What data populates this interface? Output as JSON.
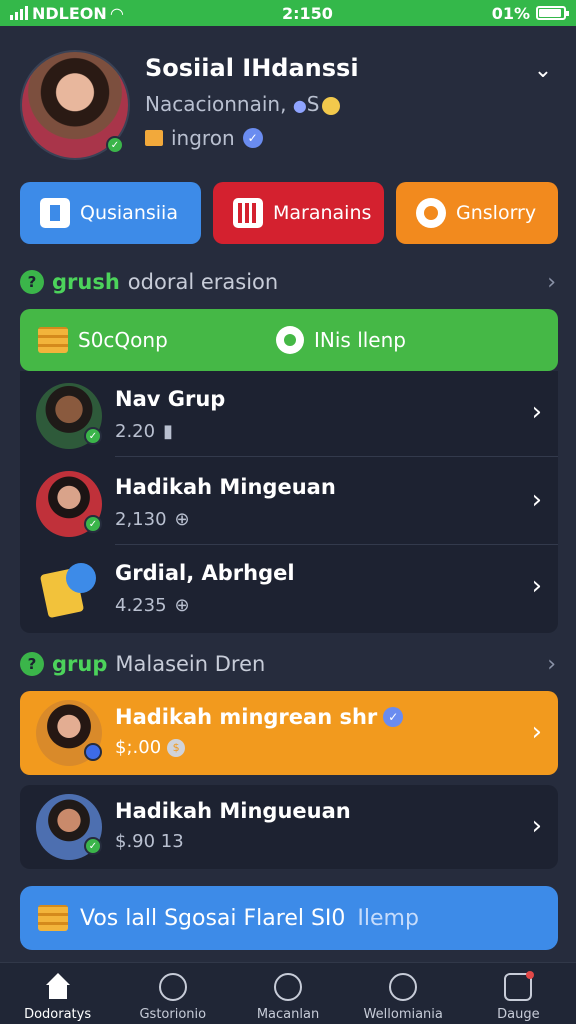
{
  "status_bar": {
    "carrier": "NDLEON",
    "time": "2:150",
    "battery": "01%"
  },
  "profile": {
    "name": "Sosiial IHdanssi",
    "subtitle": "Nacacionnain,",
    "subtitle_suffix": "S",
    "tag": "ingron"
  },
  "actions": [
    {
      "label": "Qusiansiia"
    },
    {
      "label": "Maranains"
    },
    {
      "label": "Gnslorry"
    }
  ],
  "section1": {
    "accent": "grush",
    "rest": "odoral erasion"
  },
  "green_bar": {
    "left_label": "S0cQonp",
    "right_label": "INis llenp"
  },
  "list1": [
    {
      "title": "Nav Grup",
      "meta": "2.20"
    },
    {
      "title": "Hadikah Mingeuan",
      "meta": "2,130"
    },
    {
      "title": "Grdial, Abrhgel",
      "meta": "4.235"
    }
  ],
  "section2": {
    "accent": "grup",
    "rest": "Malasein Dren"
  },
  "featured": {
    "title": "Hadikah mingrean shr",
    "meta": "$;.00"
  },
  "dark_row": {
    "title": "Hadikah Mingueuan",
    "meta": "$.90 13"
  },
  "promo": {
    "main": "Vos lall Sgosai Flarel SI0",
    "muted": "Ilemp"
  },
  "nav": [
    {
      "label": "Dodoratys"
    },
    {
      "label": "Gstorionio"
    },
    {
      "label": "Macanlan"
    },
    {
      "label": "Wellomiania"
    },
    {
      "label": "Dauge"
    }
  ],
  "colors": {
    "status_green": "#34b84a",
    "background": "#262c3d",
    "blue": "#3d8be8",
    "red": "#d4212f",
    "orange": "#f28a1e",
    "green": "#45b846"
  }
}
